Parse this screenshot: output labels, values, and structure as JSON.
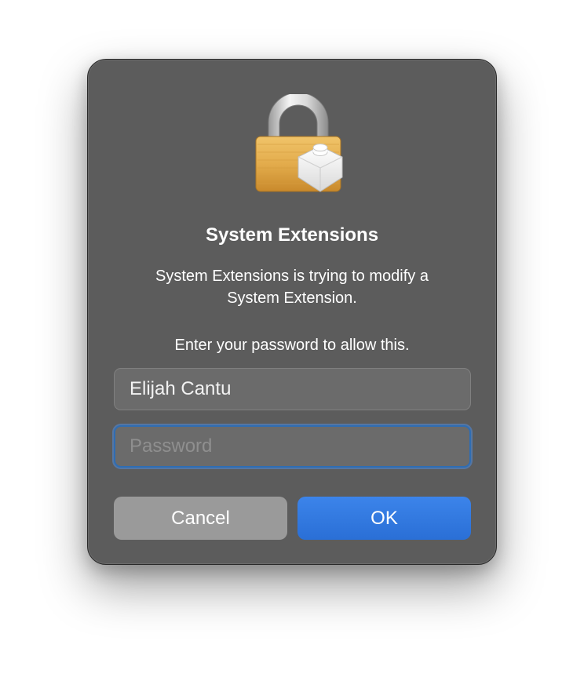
{
  "dialog": {
    "icon": "lock-with-extension-icon",
    "title": "System Extensions",
    "message_line1": "System Extensions is trying to modify a",
    "message_line2": "System Extension.",
    "prompt": "Enter your password to allow this.",
    "username": {
      "value": "Elijah Cantu"
    },
    "password": {
      "value": "",
      "placeholder": "Password"
    },
    "buttons": {
      "cancel_label": "Cancel",
      "ok_label": "OK"
    },
    "colors": {
      "background": "#5c5c5c",
      "ok_button": "#2f77e0",
      "cancel_button": "#9a9a9a",
      "focus_ring": "#2f6db3"
    }
  }
}
